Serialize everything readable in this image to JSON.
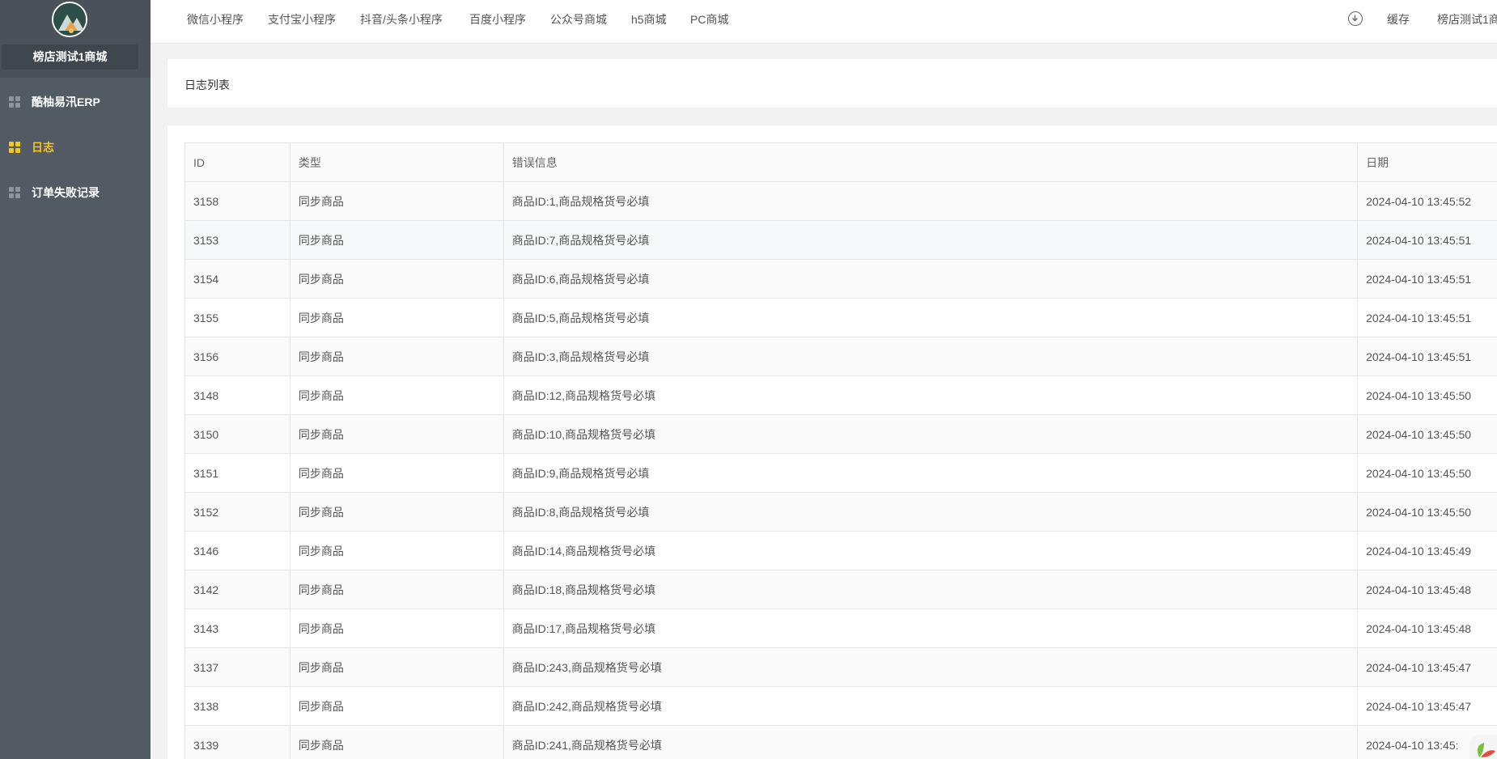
{
  "sidebar": {
    "store_name": "榜店测试1商城",
    "items": [
      {
        "label": "酷柚易汛ERP"
      },
      {
        "label": "日志"
      },
      {
        "label": "订单失败记录"
      }
    ]
  },
  "topbar": {
    "tabs": [
      {
        "label": "微信小程序"
      },
      {
        "label": "支付宝小程序"
      },
      {
        "label": "抖音/头条小程序"
      },
      {
        "label": "百度小程序"
      },
      {
        "label": "公众号商城"
      },
      {
        "label": "h5商城"
      },
      {
        "label": "PC商城"
      }
    ],
    "cache_label": "缓存",
    "store_label": "榜店测试1商"
  },
  "page": {
    "title": "日志列表"
  },
  "table": {
    "headers": [
      "ID",
      "类型",
      "错误信息",
      "日期"
    ],
    "rows": [
      [
        "3158",
        "同步商品",
        "商品ID:1,商品规格货号必填",
        "2024-04-10 13:45:52"
      ],
      [
        "3153",
        "同步商品",
        "商品ID:7,商品规格货号必填",
        "2024-04-10 13:45:51"
      ],
      [
        "3154",
        "同步商品",
        "商品ID:6,商品规格货号必填",
        "2024-04-10 13:45:51"
      ],
      [
        "3155",
        "同步商品",
        "商品ID:5,商品规格货号必填",
        "2024-04-10 13:45:51"
      ],
      [
        "3156",
        "同步商品",
        "商品ID:3,商品规格货号必填",
        "2024-04-10 13:45:51"
      ],
      [
        "3148",
        "同步商品",
        "商品ID:12,商品规格货号必填",
        "2024-04-10 13:45:50"
      ],
      [
        "3150",
        "同步商品",
        "商品ID:10,商品规格货号必填",
        "2024-04-10 13:45:50"
      ],
      [
        "3151",
        "同步商品",
        "商品ID:9,商品规格货号必填",
        "2024-04-10 13:45:50"
      ],
      [
        "3152",
        "同步商品",
        "商品ID:8,商品规格货号必填",
        "2024-04-10 13:45:50"
      ],
      [
        "3146",
        "同步商品",
        "商品ID:14,商品规格货号必填",
        "2024-04-10 13:45:49"
      ],
      [
        "3142",
        "同步商品",
        "商品ID:18,商品规格货号必填",
        "2024-04-10 13:45:48"
      ],
      [
        "3143",
        "同步商品",
        "商品ID:17,商品规格货号必填",
        "2024-04-10 13:45:48"
      ],
      [
        "3137",
        "同步商品",
        "商品ID:243,商品规格货号必填",
        "2024-04-10 13:45:47"
      ],
      [
        "3138",
        "同步商品",
        "商品ID:242,商品规格货号必填",
        "2024-04-10 13:45:47"
      ],
      [
        "3139",
        "同步商品",
        "商品ID:241,商品规格货号必填",
        "2024-04-10 13:45:"
      ]
    ]
  },
  "colors": {
    "sidebar_bg": "#525a63",
    "active": "#f5c518"
  }
}
